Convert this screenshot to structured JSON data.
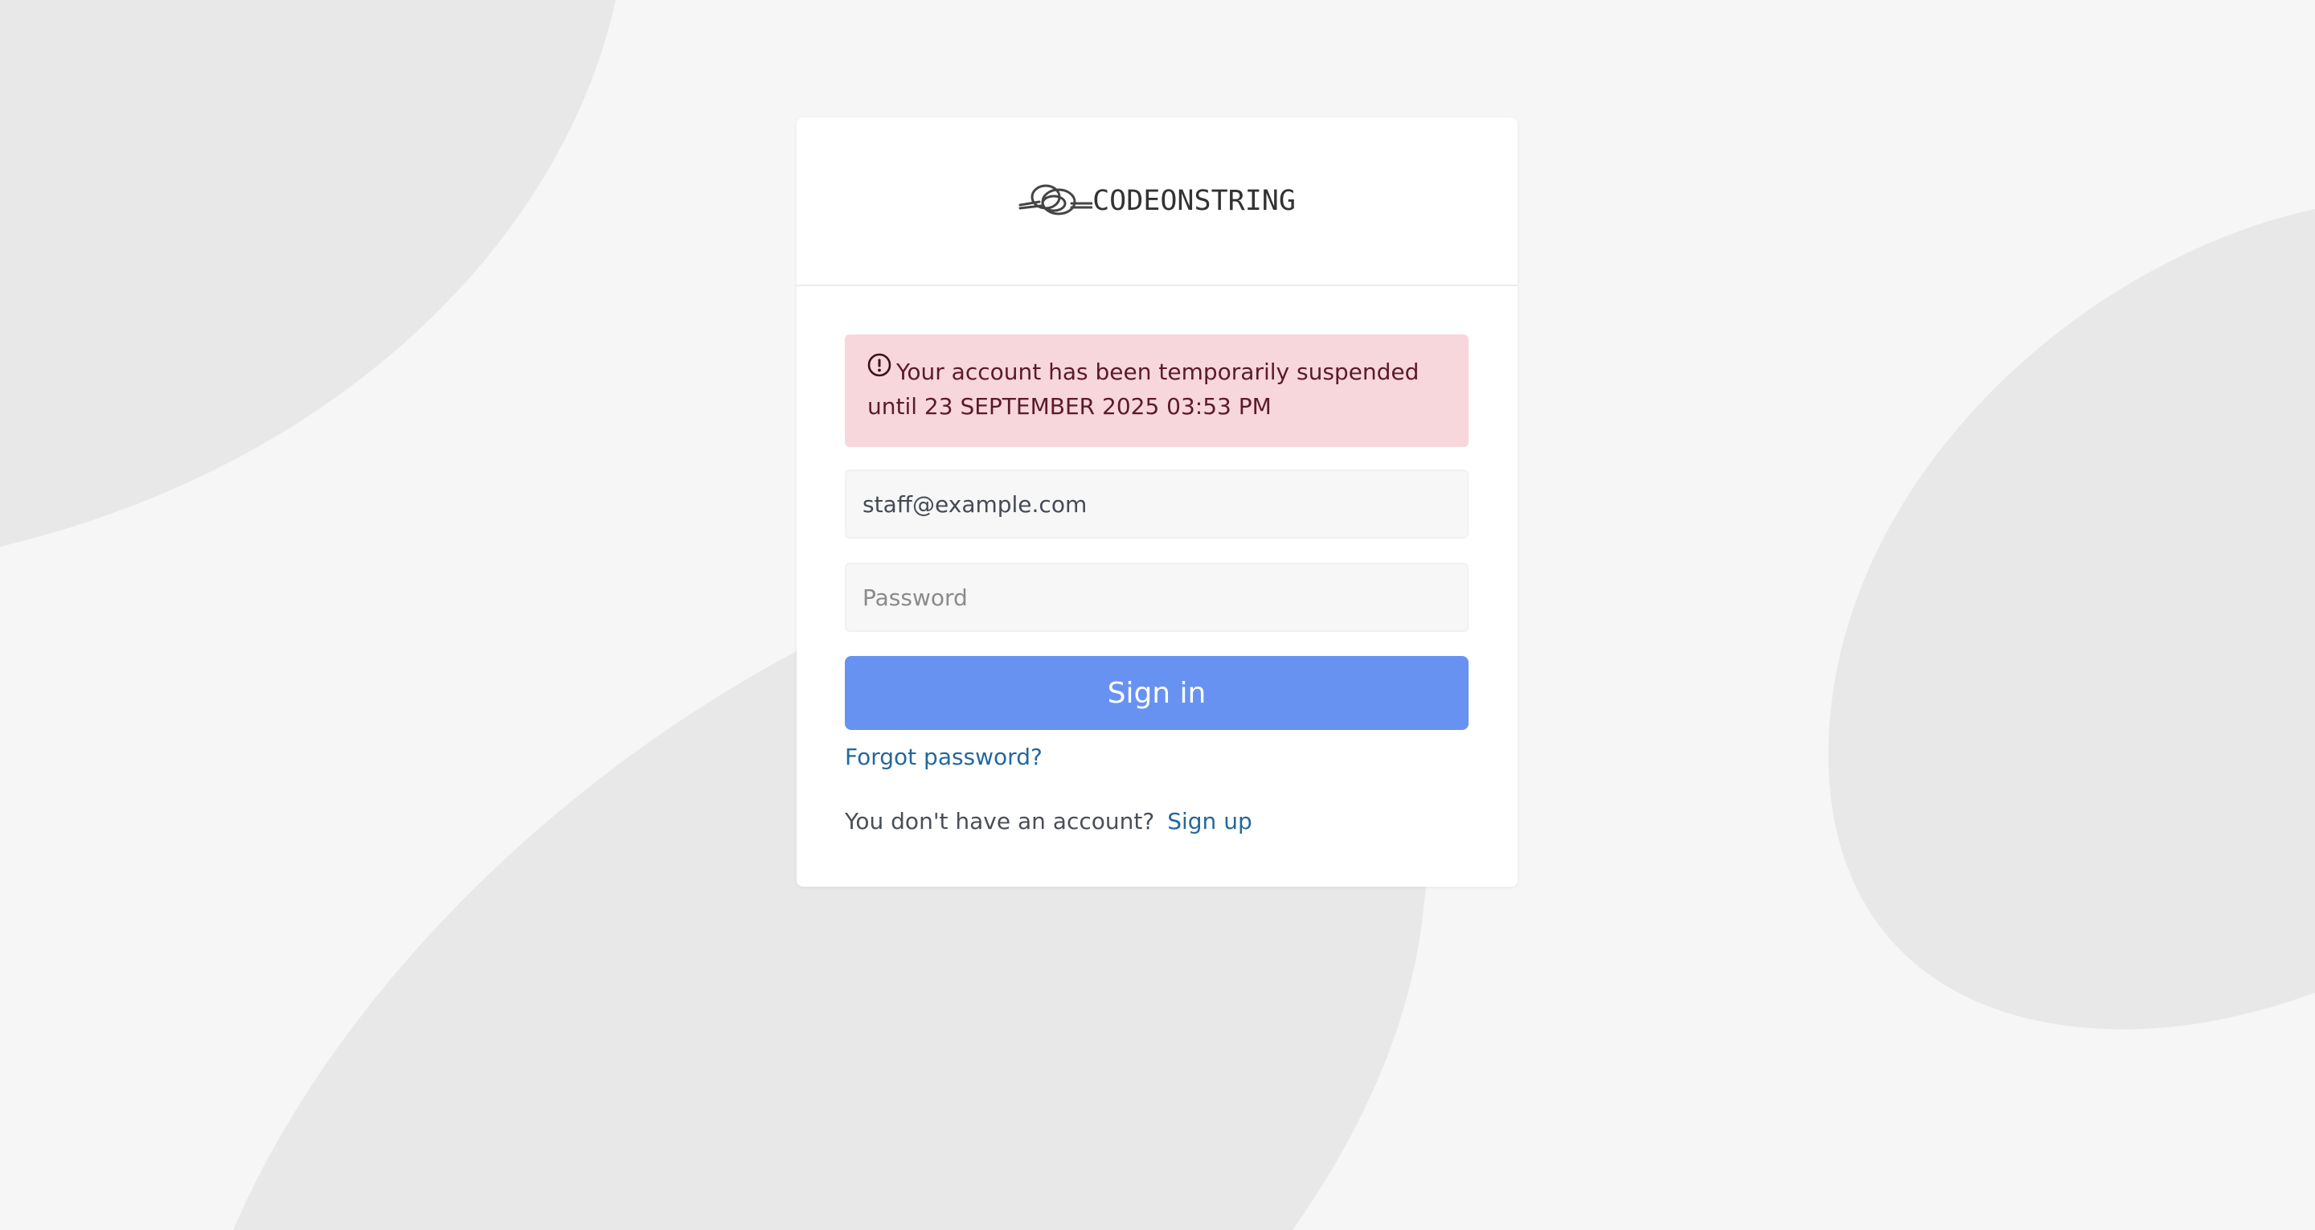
{
  "brand": {
    "name": "CODEONSTRING",
    "icon": "knot-logo-icon"
  },
  "alert": {
    "icon": "exclamation-circle-icon",
    "message": "Your account has been temporarily suspended until 23 SEPTEMBER 2025 03:53 PM",
    "color": "#f8d7dc"
  },
  "form": {
    "email": {
      "value": "staff@example.com",
      "placeholder": ""
    },
    "password": {
      "value": "",
      "placeholder": "Password"
    },
    "submit_label": "Sign in",
    "forgot_label": "Forgot password?",
    "no_account_text": "You don't have an account?",
    "signup_label": "Sign up"
  },
  "colors": {
    "accent": "#6892f2",
    "link": "#24679e",
    "background": "#f6f6f6",
    "background_shapes": "#e8e8e8"
  }
}
